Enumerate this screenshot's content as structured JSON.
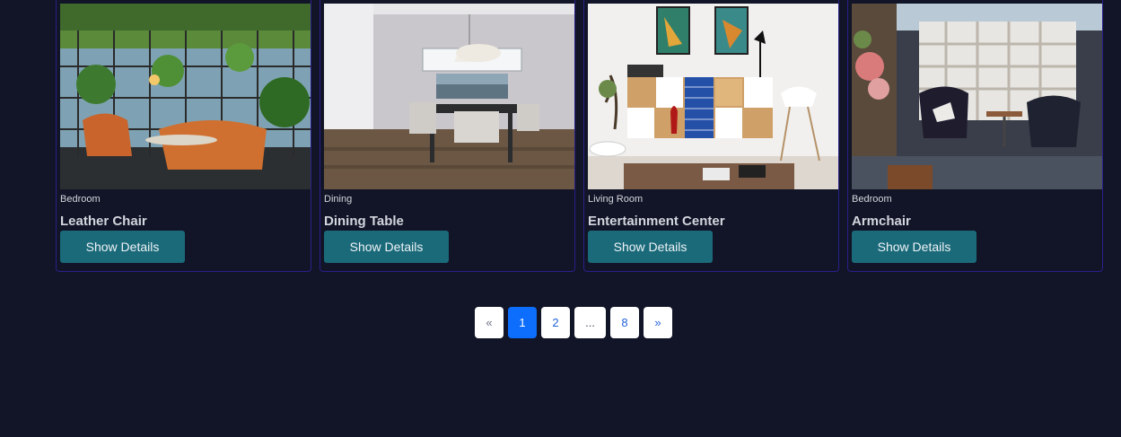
{
  "products": [
    {
      "category": "Bedroom",
      "title": "Leather Chair",
      "button": "Show Details"
    },
    {
      "category": "Dining",
      "title": "Dining Table",
      "button": "Show Details"
    },
    {
      "category": "Living Room",
      "title": "Entertainment Center",
      "button": "Show Details"
    },
    {
      "category": "Bedroom",
      "title": "Armchair",
      "button": "Show Details"
    }
  ],
  "pagination": {
    "prev": "«",
    "pages": [
      "1",
      "2",
      "...",
      "8"
    ],
    "next": "»",
    "active": "1"
  },
  "colors": {
    "background": "#111527",
    "card_border": "#2a1f8a",
    "button": "#1b6a7a",
    "active_page": "#0d6efd"
  }
}
